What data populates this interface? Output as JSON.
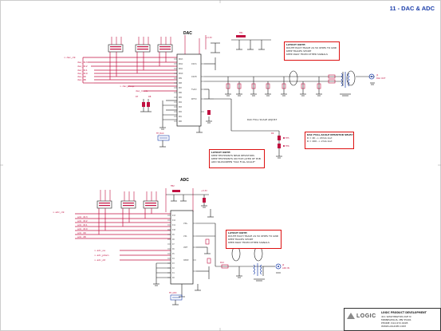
{
  "sheet": {
    "title": "11 - DAC & ADC",
    "dac_label": "DAC",
    "adc_label": "ADC"
  },
  "notes": {
    "dac_route": [
      "LAYOUT NOTE:",
      "ROUTE EACH TRACE AS 50 OHMS TO GND",
      "KEEP TRACES SHORT",
      "KEEP AWAY FROM OTHER SIGNALS"
    ],
    "dac_testpoints": [
      "LAYOUT NOTE:",
      "KEEP TESTPOINTS NEAR RESISTORS",
      "KEEP TESTPOINTS ON TOP LAYER OF PCB",
      "ADD SILKSCREEN \"DAC FULL-SCALE\""
    ],
    "dac_resistor": [
      "DAC FULL-SCALE RESISTOR SELECTION",
      "R = 2K -> 20mA Iout",
      "R = 20K -> 2mA Iout"
    ],
    "dac_fullscale": "DAC FULL SCALE ADJUST",
    "adc_route": [
      "LAYOUT NOTE:",
      "ROUTE EACH TRACE AS 50 OHMS TO GND",
      "KEEP TRACES SHORT",
      "KEEP AWAY FROM OTHER SIGNALS"
    ]
  },
  "titleblock": {
    "logo": "LOGIC",
    "company": "LOGIC PRODUCT DEVELOPMENT",
    "lines": [
      "411 WASHINGTON AVE N",
      "MINNEAPOLIS, MN 55401",
      "PHONE: 612.672.9495",
      "WWW.LOGICPD.COM"
    ]
  },
  "colors": {
    "wire": "#1a1a1a",
    "bus": "#c01040",
    "component": "#c01040",
    "net_label": "#c01040",
    "note_border": "#dd1111",
    "accent_blue": "#1c3faa",
    "conn_blue": "#1c3faa"
  }
}
